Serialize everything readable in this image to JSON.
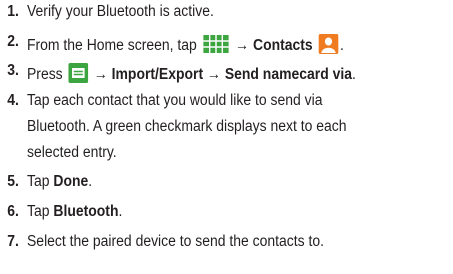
{
  "steps": [
    {
      "num": "1.",
      "text": "Verify your Bluetooth is active."
    },
    {
      "num": "2.",
      "pre": "From the Home screen, tap",
      "arrow": "→",
      "bold": "Contacts",
      "end": ".",
      "icons": [
        "apps-grid-icon",
        "contacts-person-icon"
      ]
    },
    {
      "num": "3.",
      "pre": "Press",
      "arrow": "→",
      "bold1": "Import/Export",
      "arrow2": "→",
      "bold2": "Send namecard via",
      "end": ".",
      "icons": [
        "menu-key-icon"
      ]
    },
    {
      "num": "4.",
      "line1": "Tap each contact that you would like to send via",
      "line2": "Bluetooth. A green checkmark displays next to each",
      "line3": "selected entry."
    },
    {
      "num": "5.",
      "pre": "Tap",
      "bold": "Done",
      "end": "."
    },
    {
      "num": "6.",
      "pre": "Tap",
      "bold": "Bluetooth",
      "end": "."
    },
    {
      "num": "7.",
      "text": "Select the paired device to send the contacts to."
    }
  ],
  "colors": {
    "text": "#231f20",
    "icon_green": "#3da53f",
    "icon_orange": "#f07c22"
  }
}
